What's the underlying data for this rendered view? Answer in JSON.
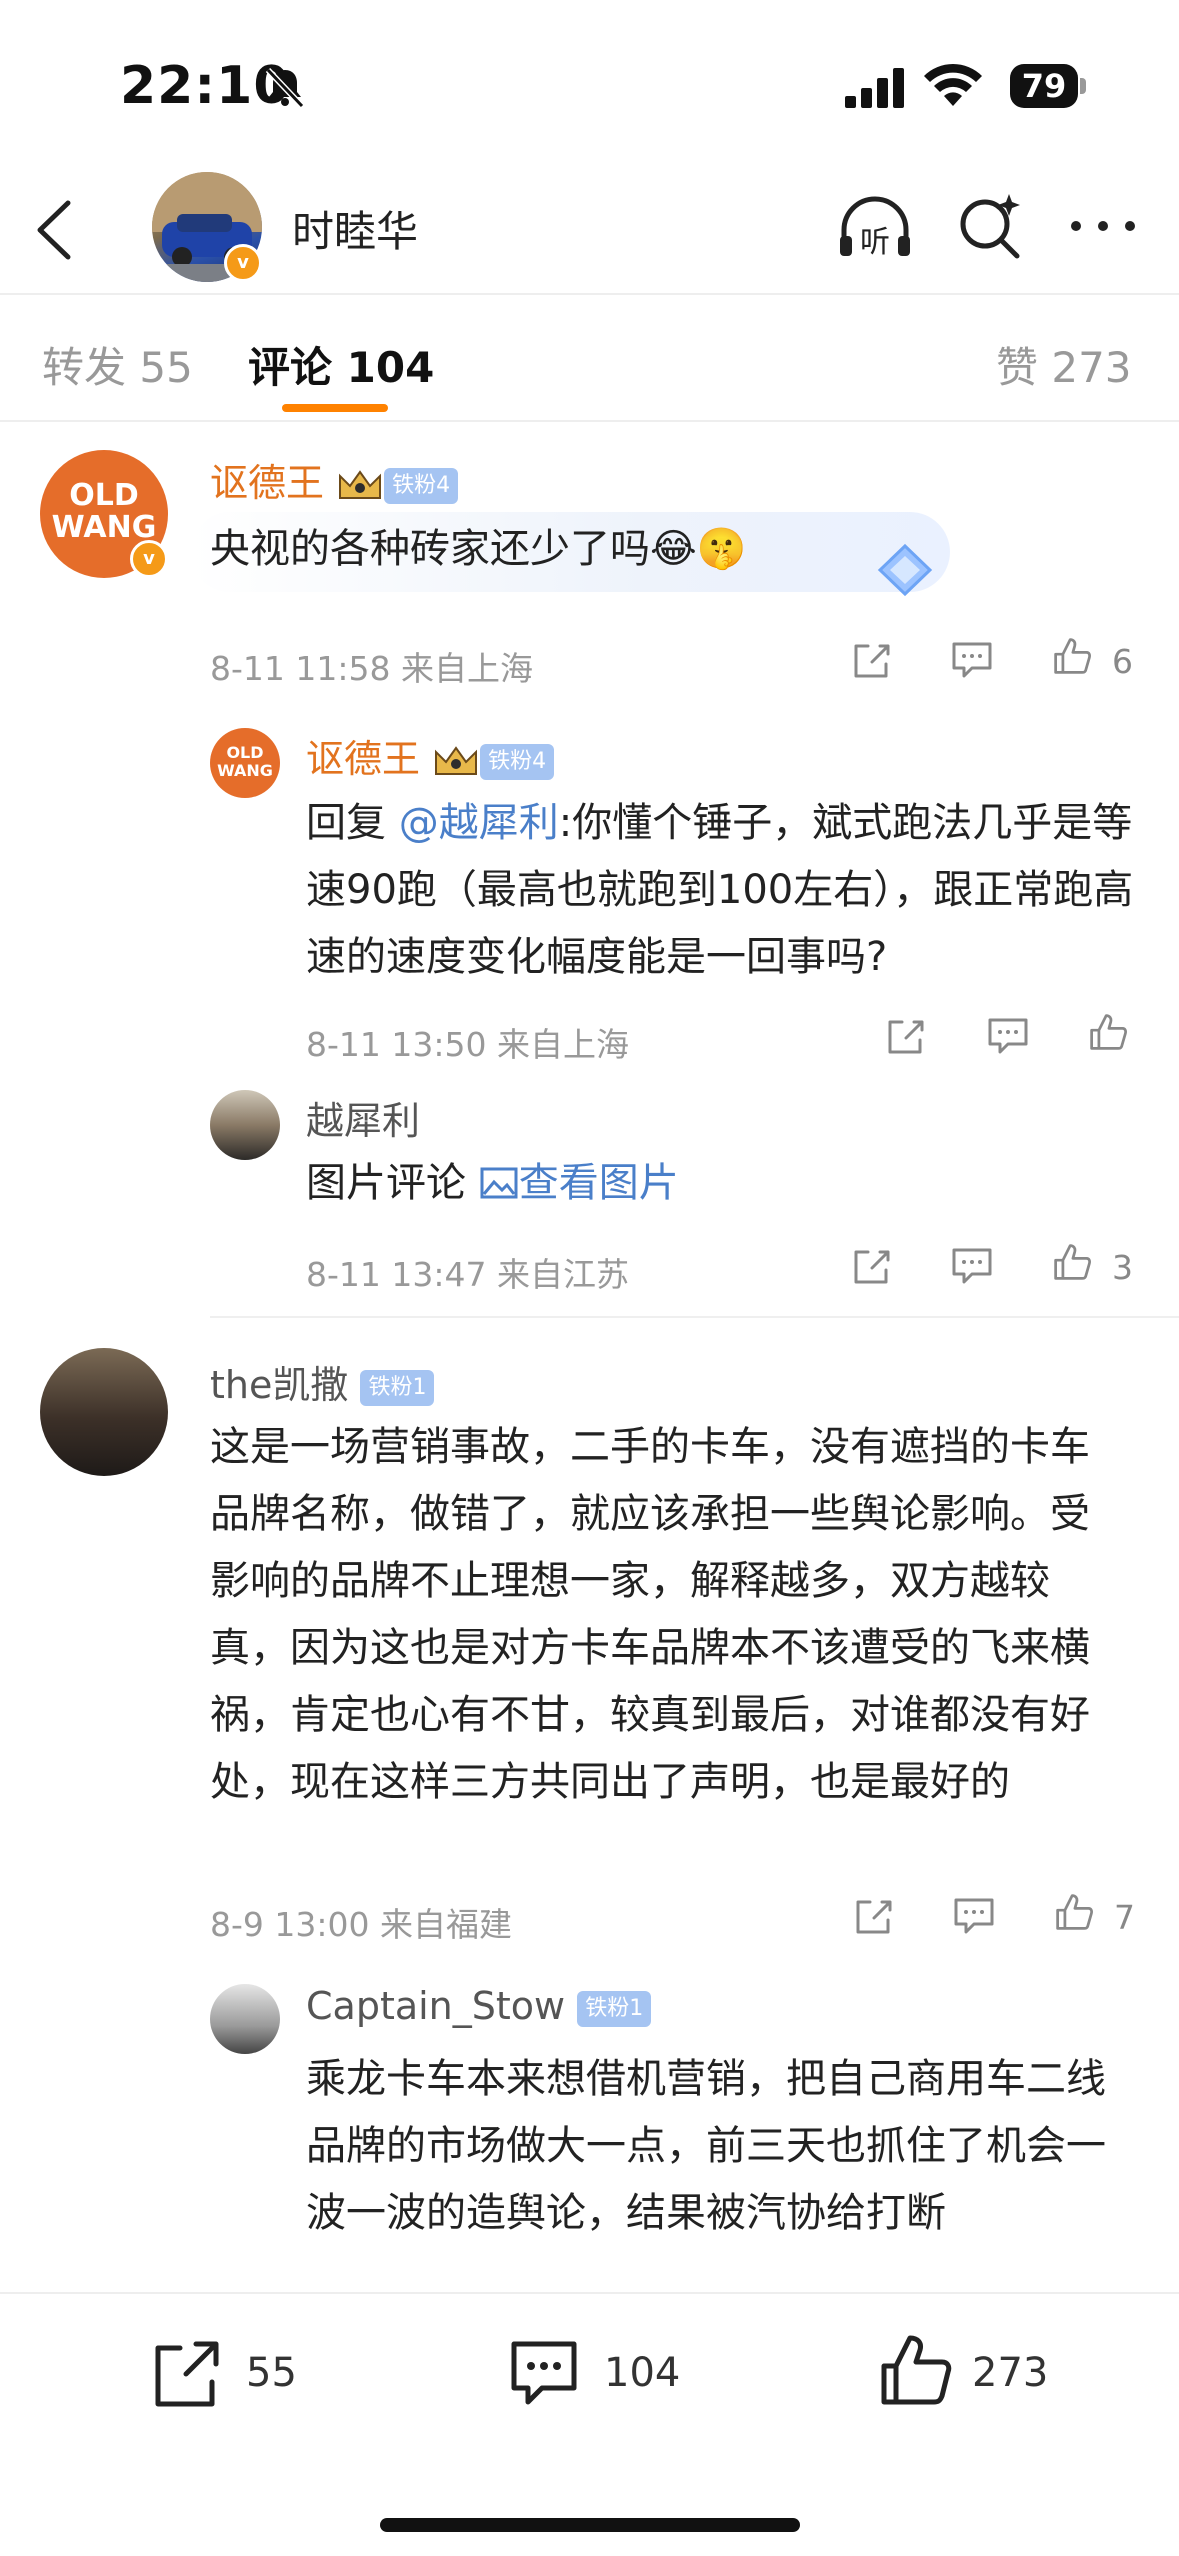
{
  "status": {
    "time": "22:10",
    "battery": "79"
  },
  "header": {
    "name": "时睦华"
  },
  "tabs": {
    "repost": "转发 55",
    "comments": "评论 104",
    "likes": "赞 273"
  },
  "comments": [
    {
      "author": "讴德王",
      "badge": "铁粉4",
      "text": "央视的各种砖家还少了吗",
      "emoji": "😂🤫",
      "meta": "8-11 11:58  来自上海",
      "likes": "6",
      "avatar_text": "OLD WANG"
    },
    {
      "author": "讴德王",
      "badge": "铁粉4",
      "reply_prefix": "回复 ",
      "mention": "@越犀利",
      "text": ":你懂个锤子，斌式跑法几乎是等速90跑（最高也就跑到100左右），跟正常跑高速的速度变化幅度能是一回事吗?",
      "meta": "8-11 13:50  来自上海",
      "likes": ""
    },
    {
      "author": "越犀利",
      "text": "图片评论 ",
      "view_pic": "查看图片",
      "meta": "8-11 13:47  来自江苏",
      "likes": "3"
    },
    {
      "author": "the凯撒",
      "badge": "铁粉1",
      "text": "这是一场营销事故，二手的卡车，没有遮挡的卡车品牌名称，做错了，就应该承担一些舆论影响。受影响的品牌不止理想一家，解释越多，双方越较真，因为这也是对方卡车品牌本不该遭受的飞来横祸，肯定也心有不甘，较真到最后，对谁都没有好处，现在这样三方共同出了声明，也是最好的",
      "meta": "8-9 13:00  来自福建",
      "likes": "7"
    },
    {
      "author": "Captain_Stow",
      "badge": "铁粉1",
      "text": "乘龙卡车本来想借机营销，把自己商用车二线品牌的市场做大一点，前三天也抓住了机会一波一波的造舆论，结果被汽协给打断"
    }
  ],
  "bottom": {
    "repost": "55",
    "comment": "104",
    "like": "273"
  },
  "colors": {
    "accent": "#ff8200",
    "name_orange": "#e2731e",
    "link": "#4a7fc9"
  },
  "icons": [
    "bell-slash-icon",
    "signal-icon",
    "wifi-icon",
    "back-icon",
    "listen-icon",
    "search-icon",
    "more-icon",
    "share-icon",
    "comment-icon",
    "like-icon",
    "image-icon"
  ]
}
